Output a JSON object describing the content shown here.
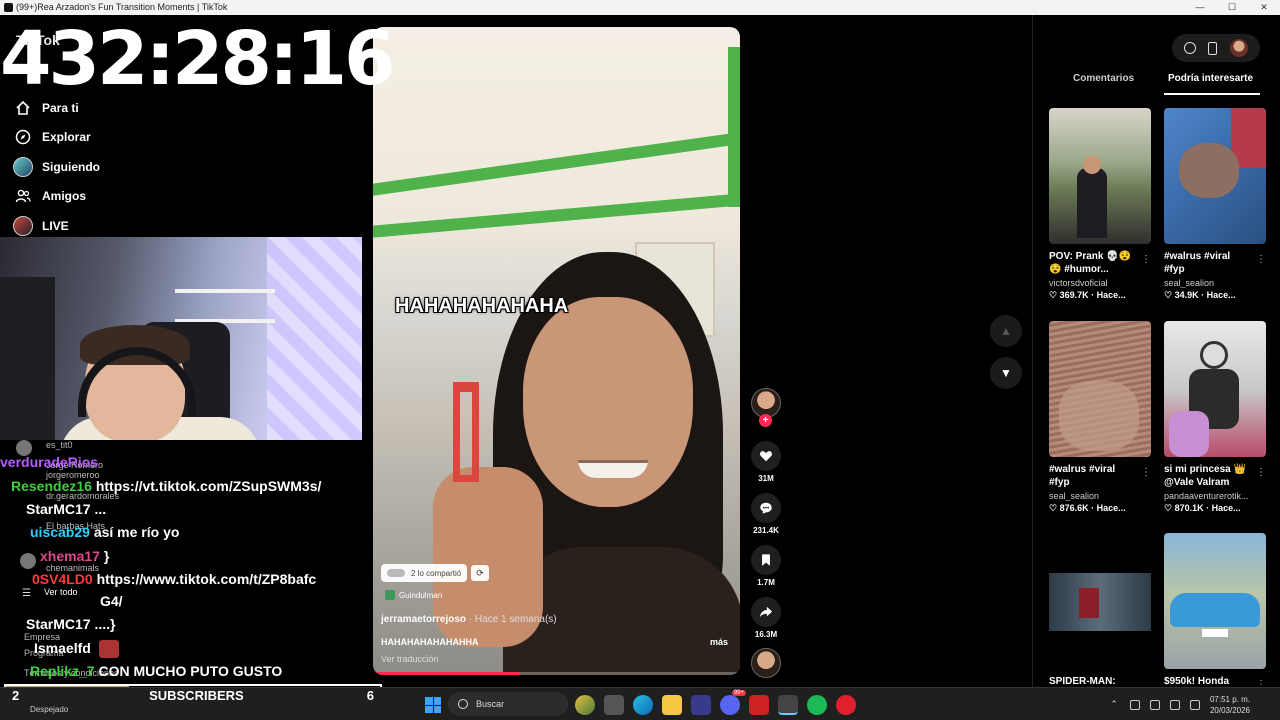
{
  "window": {
    "title": "(99+)Rea Arzadon's Fun Transition Moments | TikTok",
    "controls": [
      "—",
      "☐",
      "✕"
    ]
  },
  "overlay": {
    "timer": "432:28:16",
    "logo": "TikTok"
  },
  "sidebar": {
    "items": [
      {
        "label": "Para ti",
        "icon": "home-icon"
      },
      {
        "label": "Explorar",
        "icon": "compass-icon"
      },
      {
        "label": "Siguiendo",
        "icon": "avatar-icon"
      },
      {
        "label": "Amigos",
        "icon": "friends-icon"
      },
      {
        "label": "LIVE",
        "icon": "live-avatar-icon"
      }
    ],
    "ghost_items": [
      "Empresa",
      "Programa",
      "Términos y condiciones"
    ]
  },
  "chat": {
    "ghost_users": [
      "es_tit0",
      "Jorge Romero",
      "jorgeromeroo",
      "dr.gerardomorales",
      "El barbas Hats",
      "chemanimals",
      "Ver todo"
    ],
    "lines": [
      {
        "user": "verduradeRios",
        "color": "#b65cff",
        "msg": ""
      },
      {
        "user": "Resendez16",
        "color": "#3cd13c",
        "msg": "https://vt.tiktok.com/ZSupSWM3s/"
      },
      {
        "user": "StarMC17",
        "color": "#ffffff",
        "msg": "..."
      },
      {
        "user": "uiscab29",
        "color": "#2ad1ff",
        "msg": "así me río yo"
      },
      {
        "user": "xhema17",
        "color": "#e0498d",
        "msg": "}"
      },
      {
        "user": "0SV4LD0",
        "color": "#ff3b3b",
        "msg": "https://www.tiktok.com/t/ZP8bafc"
      },
      {
        "user": "",
        "color": "#ffffff",
        "msg": "G4/"
      },
      {
        "user": "StarMC17",
        "color": "#ffffff",
        "msg": "....}"
      },
      {
        "user": "Ismaelfd",
        "color": "#ffffff",
        "msg": ""
      },
      {
        "user": "Replikz_7",
        "color": "#3cd13c",
        "msg": "CON MUCHO PUTO GUSTO"
      }
    ]
  },
  "subscribers": {
    "current": "2",
    "label": "SUBSCRIBERS",
    "goal": "6",
    "progress": 0.33,
    "fill_color": "#b8a46c"
  },
  "video": {
    "overlay_text": "HAHAHAHAHAHA",
    "shared_label": "2 lo compartió",
    "group_tag": "Guindulman",
    "author": "jerramaetorrejoso",
    "time_ago": "· Hace 1 semana(s)",
    "caption": "HAHAHAHAHAHAHHA",
    "more_label": "más",
    "translate_label": "Ver traducción",
    "progress": 0.4,
    "progress_color": "#fe2c55"
  },
  "actions": {
    "like_count": "31M",
    "comment_count": "231.4K",
    "save_count": "1.7M",
    "share_count": "16.3M",
    "follow_plus": "+"
  },
  "right_panel": {
    "tabs": [
      "Comentarios",
      "Podría interesarte"
    ],
    "active_tab": 1,
    "cards": [
      {
        "line1": "POV: Prank 💀😵",
        "line2": "😵 #humor...",
        "author": "victorsdvoficial",
        "likes": "♡ 369.7K · Hace..."
      },
      {
        "line1": "#walrus #viral",
        "line2": "#fyp",
        "author": "seal_sealion",
        "likes": "♡ 34.9K · Hace..."
      },
      {
        "line1": "#walrus #viral",
        "line2": "#fyp",
        "author": "seal_sealion",
        "likes": "♡ 876.6K · Hace..."
      },
      {
        "line1": "si mi princesa 👑",
        "line2": "@Vale Valram",
        "author": "pandaaventurerotik...",
        "likes": "♡ 870.1K · Hace..."
      },
      {
        "line1": "SPIDER-MAN:",
        "line2": "",
        "author": "",
        "likes": ""
      },
      {
        "line1": "$950k! Honda",
        "line2": "",
        "author": "",
        "likes": ""
      }
    ],
    "more_icon": "⋮"
  },
  "taskbar": {
    "weather": "Despejado",
    "search_placeholder": "Buscar",
    "badge_count": "99+",
    "time": "07:51 p. m.",
    "date": "20/03/2026",
    "tray_chevron": "⌃"
  }
}
